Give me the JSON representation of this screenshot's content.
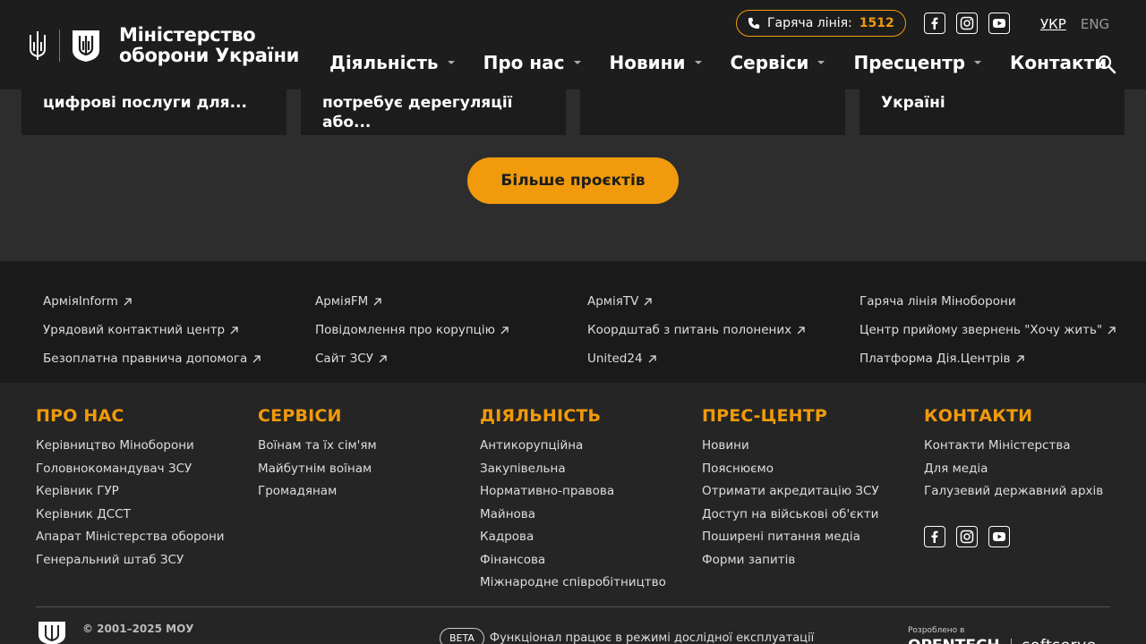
{
  "header": {
    "logo_line1": "Міністерство",
    "logo_line2": "оборони України",
    "hotline_label": "Гаряча лінія:",
    "hotline_number": "1512",
    "lang_active": "УКР",
    "lang_other": "ENG",
    "nav": [
      {
        "label": "Діяльність"
      },
      {
        "label": "Про нас"
      },
      {
        "label": "Новини"
      },
      {
        "label": "Сервіси"
      },
      {
        "label": "Пресцентр"
      },
      {
        "label": "Контакти"
      }
    ]
  },
  "cards": [
    {
      "text": "цифрові послуги для..."
    },
    {
      "text": "потребує дерегуляції або..."
    },
    {
      "text": ""
    },
    {
      "text": "Україні"
    }
  ],
  "more_projects": "Більше проєктів",
  "links": {
    "col1": [
      "АрміяInform",
      "Урядовий контактний центр",
      "Безоплатна правнича допомога"
    ],
    "col2": [
      "АрміяFM",
      "Повідомлення про корупцію",
      "Сайт ЗСУ"
    ],
    "col3": [
      "АрміяTV",
      "Коордштаб з питань полонених",
      "United24"
    ],
    "col4": [
      "Гаряча лінія Міноборони",
      "Центр прийому звернень \"Хочу жить\"",
      "Платформа Дія.Центрів"
    ]
  },
  "footer": {
    "about": {
      "title": "ПРО НАС",
      "items": [
        "Керівництво Міноборони",
        "Головнокомандувач ЗСУ",
        "Керівник ГУР",
        "Керівник ДССТ",
        "Апарат Міністерства оборони",
        "Генеральний штаб ЗСУ"
      ]
    },
    "services": {
      "title": "СЕРВІСИ",
      "items": [
        "Воїнам та їх сім'ям",
        "Майбутнім воїнам",
        "Громадянам"
      ]
    },
    "activity": {
      "title": "ДІЯЛЬНІСТЬ",
      "items": [
        "Антикорупційна",
        "Закупівельна",
        "Нормативно-правова",
        "Майнова",
        "Кадрова",
        "Фінансова",
        "Міжнародне співробітництво"
      ]
    },
    "press": {
      "title": "ПРЕС-ЦЕНТР",
      "items": [
        "Новини",
        "Пояснюємо",
        "Отримати акредитацію ЗСУ",
        "Доступ на військові об'єкти",
        "Поширені питання медіа",
        "Форми запитів"
      ]
    },
    "contacts": {
      "title": "КОНТАКТИ",
      "items": [
        "Контакти Міністерства",
        "Для медіа",
        "Галузевий державний архів"
      ]
    },
    "copyright": "© 2001–2025 МОУ",
    "beta_badge": "BETA",
    "beta_text": "Функціонал працює в режимі дослідної експлуатації",
    "dev_label": "Розроблено в",
    "dev_company1": "OPENTECH",
    "dev_company2": "softserve"
  },
  "colors": {
    "accent": "#f09a0c",
    "header_bg": "#1d1d1d",
    "page_bg": "#2d2d2d"
  }
}
